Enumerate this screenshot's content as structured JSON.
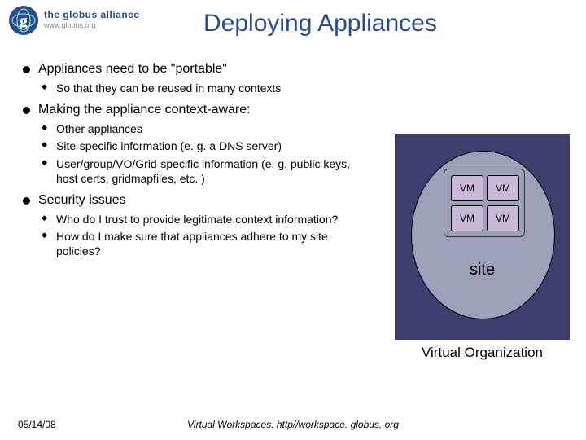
{
  "logo": {
    "brand_top": "the globus alliance",
    "brand_bottom": "www.globus.org",
    "g": "g"
  },
  "title": "Deploying Appliances",
  "bullets": [
    {
      "text": "Appliances need to be \"portable\"",
      "sub": [
        "So that they can be reused in many contexts"
      ]
    },
    {
      "text": "Making the appliance context-aware:",
      "sub": [
        "Other appliances",
        "Site-specific information (e. g. a DNS server)",
        "User/group/VO/Grid-specific information (e. g. public keys, host certs, gridmapfiles, etc. )"
      ]
    },
    {
      "text": "Security issues",
      "sub": [
        "Who do I trust to provide legitimate context information?",
        "How do I make sure that appliances adhere to my site policies?"
      ]
    }
  ],
  "diagram": {
    "vm": "VM",
    "site": "site",
    "vo": "Virtual Organization"
  },
  "footer": {
    "date": "05/14/08",
    "center": "Virtual Workspaces: http//workspace. globus. org"
  }
}
